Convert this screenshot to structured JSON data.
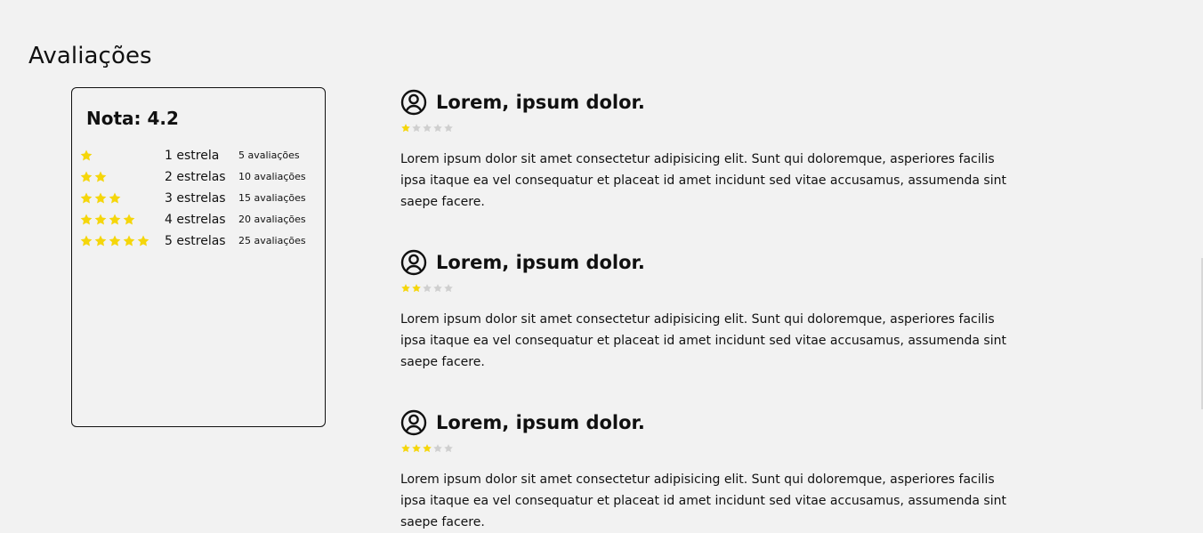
{
  "page": {
    "title": "Avaliações"
  },
  "summary": {
    "title": "Nota: 4.2",
    "rating_value": 4.2,
    "distribution": [
      {
        "stars": 1,
        "label": "1 estrela",
        "count": "5 avaliações"
      },
      {
        "stars": 2,
        "label": "2 estrelas",
        "count": "10 avaliações"
      },
      {
        "stars": 3,
        "label": "3 estrelas",
        "count": "15 avaliações"
      },
      {
        "stars": 4,
        "label": "4 estrelas",
        "count": "20 avaliações"
      },
      {
        "stars": 5,
        "label": "5 estrelas",
        "count": "25 avaliações"
      }
    ]
  },
  "reviews": [
    {
      "name": "Lorem, ipsum dolor.",
      "rating": 1,
      "max_rating": 5,
      "text": "Lorem ipsum dolor sit amet consectetur adipisicing elit. Sunt qui doloremque, asperiores facilis ipsa itaque ea vel consequatur et placeat id amet incidunt sed vitae accusamus, assumenda sint saepe facere."
    },
    {
      "name": "Lorem, ipsum dolor.",
      "rating": 2,
      "max_rating": 5,
      "text": "Lorem ipsum dolor sit amet consectetur adipisicing elit. Sunt qui doloremque, asperiores facilis ipsa itaque ea vel consequatur et placeat id amet incidunt sed vitae accusamus, assumenda sint saepe facere."
    },
    {
      "name": "Lorem, ipsum dolor.",
      "rating": 3,
      "max_rating": 5,
      "text": "Lorem ipsum dolor sit amet consectetur adipisicing elit. Sunt qui doloremque, asperiores facilis ipsa itaque ea vel consequatur et placeat id amet incidunt sed vitae accusamus, assumenda sint saepe facere."
    }
  ],
  "icons": {
    "star": "star-icon",
    "avatar": "user-circle-icon"
  },
  "colors": {
    "star_filled": "#f5d60a",
    "star_empty": "#cfcfcf",
    "background": "#f2f2f2",
    "text": "#111111"
  }
}
